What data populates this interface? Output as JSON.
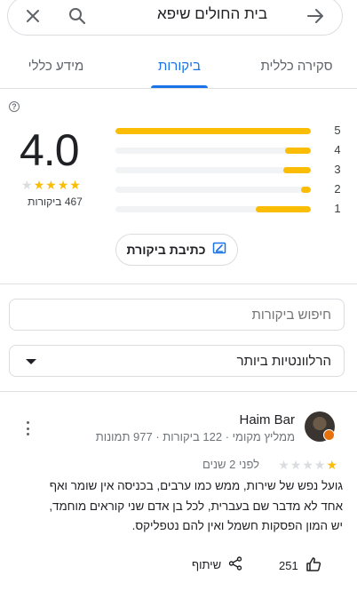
{
  "search": {
    "query": "בית החולים שיפא"
  },
  "tabs": [
    {
      "label": "סקירה כללית"
    },
    {
      "label": "ביקורות"
    },
    {
      "label": "מידע כללי"
    }
  ],
  "rating_summary": {
    "average": "4.0",
    "stars_filled": 4,
    "review_count_text": "467 ביקורות",
    "distribution": [
      {
        "stars": "5",
        "fraction": 1.0
      },
      {
        "stars": "4",
        "fraction": 0.13
      },
      {
        "stars": "3",
        "fraction": 0.14
      },
      {
        "stars": "2",
        "fraction": 0.05
      },
      {
        "stars": "1",
        "fraction": 0.28
      }
    ]
  },
  "write_review": {
    "label": "כתיבת ביקורת"
  },
  "search_reviews": {
    "placeholder": "חיפוש ביקורות"
  },
  "sort": {
    "selected": "הרלוונטיות ביותר"
  },
  "review": {
    "author": "Haim Bar",
    "meta": "ממליץ מקומי · 122 ביקורות · 977 תמונות",
    "stars_filled": 1,
    "date": "לפני 2 שנים",
    "text_lines": [
      "גועל נפש של שירות, ממש כמו ערבים, בכניסה אין שומר ואף",
      "אחד לא מדבר שם בעברית, לכל בן אדם שני קוראים מוחמד,",
      "יש המון הפסקות חשמל ואין להם נטפליקס."
    ],
    "likes": "251",
    "share_label": "שיתוף"
  },
  "colors": {
    "accent": "#1a73e8",
    "star": "#fbbc04",
    "track": "#f1f3f4"
  }
}
